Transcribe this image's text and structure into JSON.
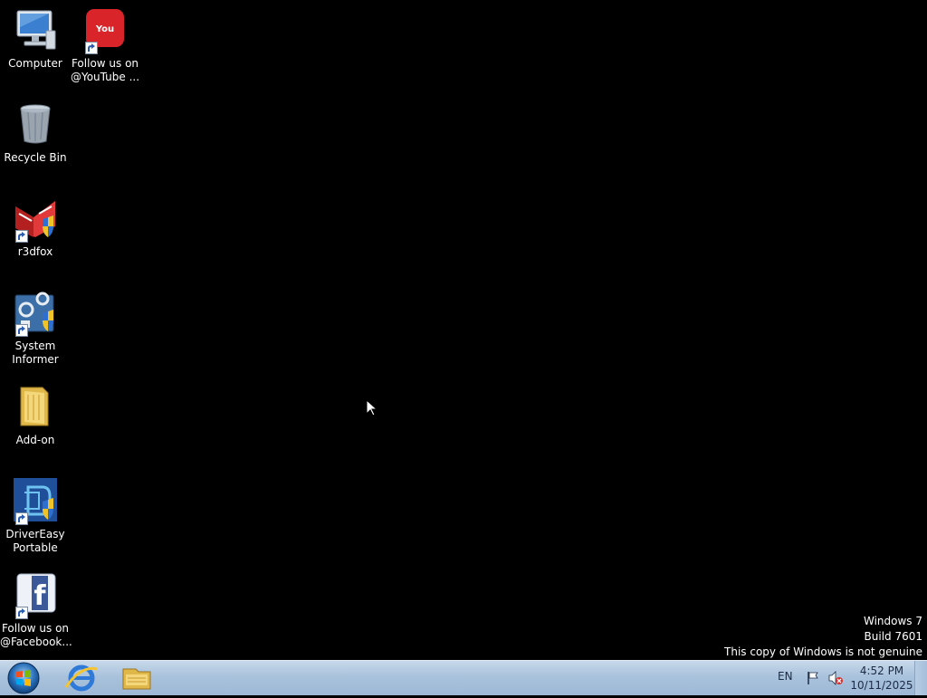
{
  "desktop": {
    "icons": [
      {
        "label": "Computer",
        "icon": "computer-icon"
      },
      {
        "label": "Follow us on\n@YouTube ...",
        "icon": "youtube-icon"
      },
      {
        "label": "Recycle Bin",
        "icon": "recycle-bin-icon"
      },
      {
        "label": "r3dfox",
        "icon": "r3dfox-icon"
      },
      {
        "label": "System\nInformer",
        "icon": "system-informer-icon"
      },
      {
        "label": "Add-on",
        "icon": "folder-icon"
      },
      {
        "label": "DriverEasy\nPortable",
        "icon": "drivereasy-icon"
      },
      {
        "label": "Follow us on\n@Facebook...",
        "icon": "facebook-icon"
      }
    ]
  },
  "watermark": {
    "line1": "Windows 7",
    "line2": "Build 7601",
    "line3": "This copy of Windows is not genuine"
  },
  "taskbar": {
    "pinned": [
      "internet-explorer-icon",
      "windows-explorer-icon"
    ],
    "language": "EN",
    "time": "4:52 PM",
    "date": "10/11/2025"
  },
  "colors": {
    "desktop_bg": "#000000",
    "taskbar_bg": "#a9c2dc",
    "youtube_red": "#d9252a",
    "facebook_blue": "#3b5998"
  }
}
